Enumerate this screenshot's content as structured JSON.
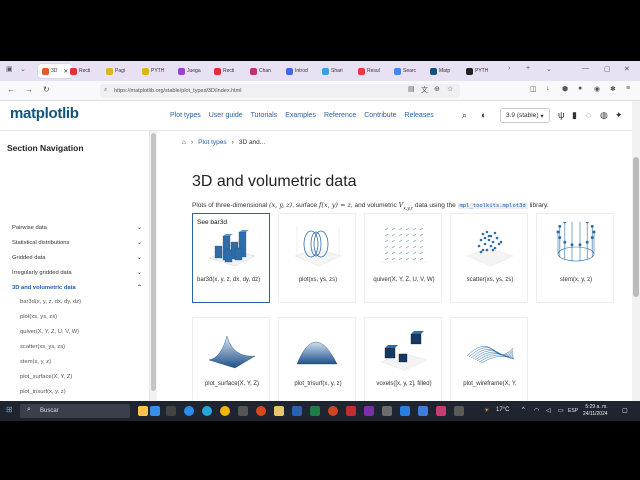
{
  "browser": {
    "tabs": [
      {
        "label": "3D",
        "active": true,
        "color": "#e65a2a"
      },
      {
        "label": "Recti",
        "color": "#d33"
      },
      {
        "label": "Pagi",
        "color": "#e0b41a"
      },
      {
        "label": "PYTH",
        "color": "#e0b41a"
      },
      {
        "label": "Juega",
        "color": "#9b3fd6"
      },
      {
        "label": "Recti",
        "color": "#d33"
      },
      {
        "label": "Chan",
        "color": "#c4306e"
      },
      {
        "label": "Introd",
        "color": "#3d6be0"
      },
      {
        "label": "Shari",
        "color": "#3aa0e0"
      },
      {
        "label": "Resul",
        "color": "#e53b3b"
      },
      {
        "label": "Searc",
        "color": "#4285f4"
      },
      {
        "label": "Matp",
        "color": "#11557c"
      },
      {
        "label": "PYTH",
        "color": "#222"
      }
    ],
    "url": "https://matplotlib.org/stable/plot_types/3D/index.html"
  },
  "header": {
    "logo": "matplotlib",
    "nav": [
      "Plot types",
      "User guide",
      "Tutorials",
      "Examples",
      "Reference",
      "Contribute",
      "Releases"
    ],
    "version": "3.9 (stable)"
  },
  "sidebar": {
    "title": "Section Navigation",
    "items": [
      {
        "label": "Pairwise data"
      },
      {
        "label": "Statistical distributions"
      },
      {
        "label": "Gridded data"
      },
      {
        "label": "Irregularly gridded data"
      },
      {
        "label": "3D and volumetric data"
      }
    ],
    "subitems": [
      "bar3d(x, y, z, dx, dy, dz)",
      "plot(xs, ys, zs)",
      "quiver(X, Y, Z, U, V, W)",
      "scatter(xs, ys, zs)",
      "stem(x, y, z)",
      "plot_surface(X, Y, Z)",
      "plot_trisurf(x, y, z)",
      "voxels([x, y, z], filled)",
      "plot_wireframe(X, Y, Z)"
    ]
  },
  "main": {
    "breadcrumb": {
      "section": "Plot types",
      "current": "3D and..."
    },
    "title": "3D and volumetric data",
    "intro": {
      "prefix": "Plots of three-dimensional",
      "coords": "(x, y, z)",
      "mid1": ", surface",
      "fn": "f(x, y) = z",
      "mid2": ", and volumetric",
      "vol": "V",
      "vol_sub": "x,y,z",
      "mid3": "data using the",
      "code": "mpl_toolkits.mplot3d",
      "suffix": "library."
    },
    "see_label": "See bar3d",
    "cards": [
      "bar3d(x, y, z, dx, dy, dz)",
      "plot(xs, ys, zs)",
      "quiver(X, Y, Z, U, V, W)",
      "scatter(xs, ys, zs)",
      "stem(x, y, z)",
      "plot_surface(X, Y, Z)",
      "plot_trisurf(x, y, z)",
      "voxels([x, y, z], filled)",
      "plot_wireframe(X, Y,"
    ]
  },
  "taskbar": {
    "search": "Buscar",
    "temperature": "17°C",
    "lang": "ESP",
    "time": "5:29 a. m.",
    "date": "24/11/2024"
  }
}
